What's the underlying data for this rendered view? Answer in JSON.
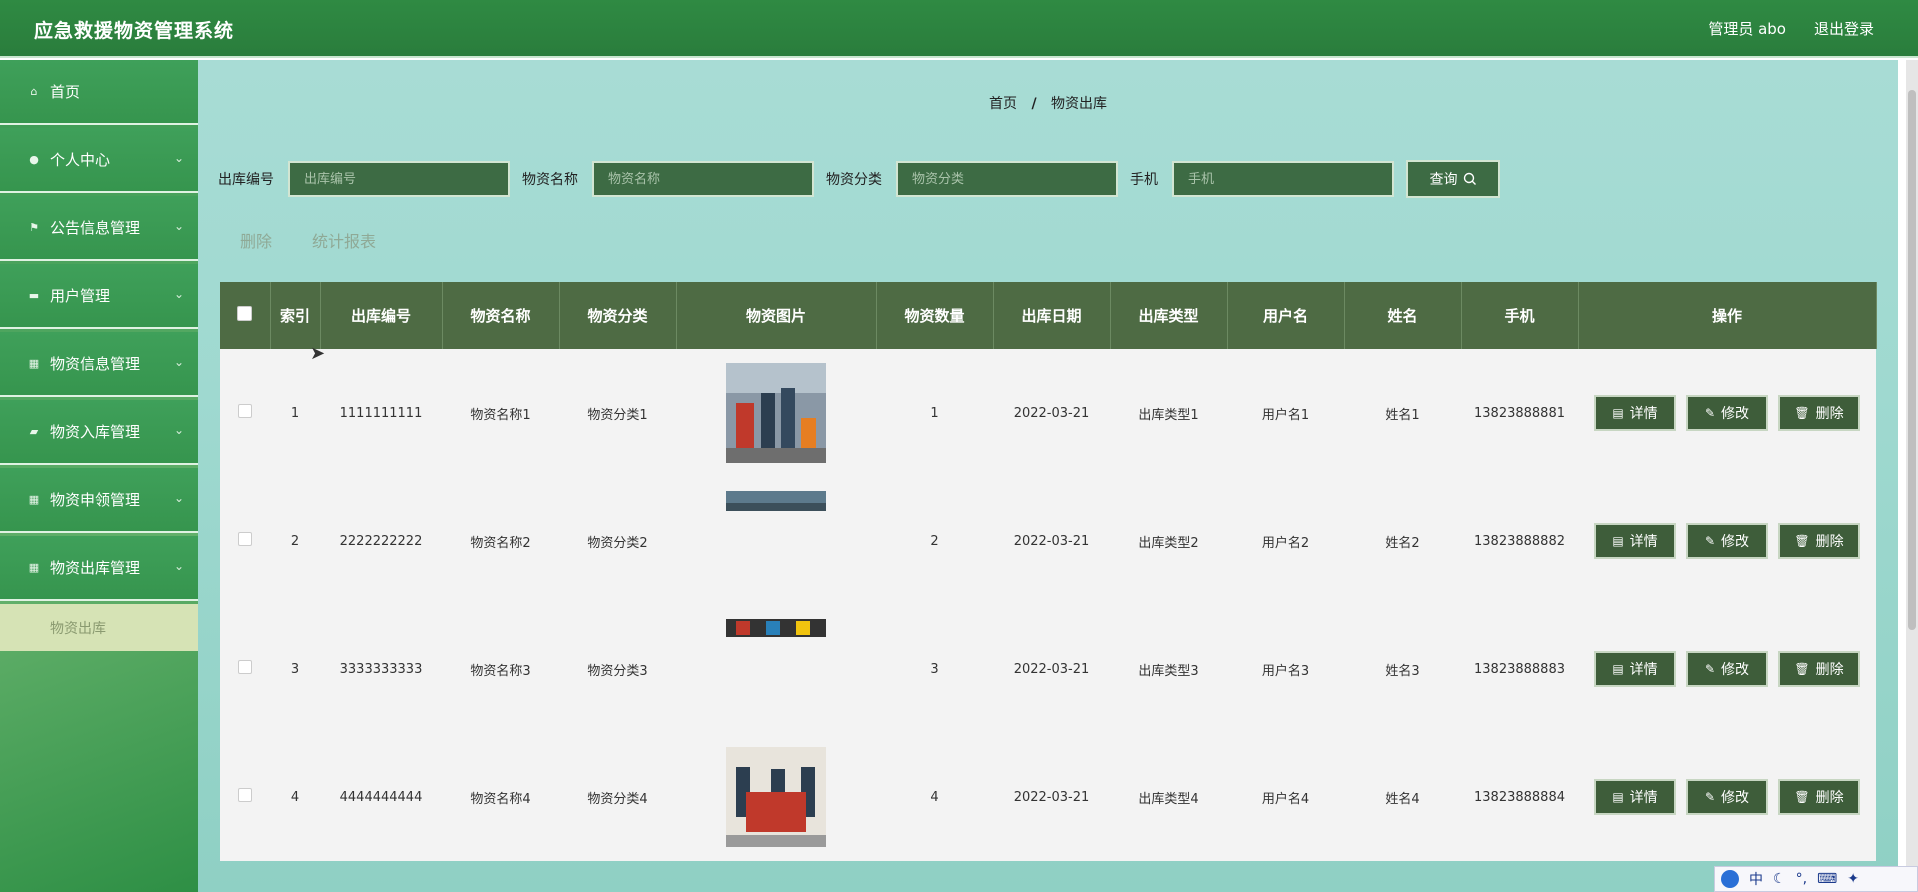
{
  "header": {
    "title": "应急救援物资管理系统",
    "user": "管理员 abo",
    "logout": "退出登录"
  },
  "sidebar": {
    "items": [
      {
        "label": "首页",
        "icon": "home-icon",
        "glyph": "⌂",
        "chevron": false
      },
      {
        "label": "个人中心",
        "icon": "user-icon",
        "glyph": "●",
        "chevron": true
      },
      {
        "label": "公告信息管理",
        "icon": "flag-icon",
        "glyph": "⚑",
        "chevron": true
      },
      {
        "label": "用户管理",
        "icon": "card-icon",
        "glyph": "▬",
        "chevron": true
      },
      {
        "label": "物资信息管理",
        "icon": "grid-icon",
        "glyph": "▦",
        "chevron": true
      },
      {
        "label": "物资入库管理",
        "icon": "comment-icon",
        "glyph": "▰",
        "chevron": true
      },
      {
        "label": "物资申领管理",
        "icon": "grid-icon",
        "glyph": "▦",
        "chevron": true
      },
      {
        "label": "物资出库管理",
        "icon": "grid-icon",
        "glyph": "▦",
        "chevron": true
      }
    ],
    "subitem": "物资出库"
  },
  "breadcrumb": {
    "home": "首页",
    "sep": "/",
    "current": "物资出库"
  },
  "search": {
    "fields": [
      {
        "label": "出库编号",
        "placeholder": "出库编号"
      },
      {
        "label": "物资名称",
        "placeholder": "物资名称"
      },
      {
        "label": "物资分类",
        "placeholder": "物资分类"
      },
      {
        "label": "手机",
        "placeholder": "手机"
      }
    ],
    "query_label": "查询",
    "query_icon": "search-icon"
  },
  "actions": {
    "delete": "删除",
    "report": "统计报表"
  },
  "table": {
    "headers": [
      "",
      "索引",
      "出库编号",
      "物资名称",
      "物资分类",
      "物资图片",
      "物资数量",
      "出库日期",
      "出库类型",
      "用户名",
      "姓名",
      "手机",
      "操作"
    ],
    "rows": [
      {
        "index": "1",
        "code": "1111111111",
        "name": "物资名称1",
        "category": "物资分类1",
        "qty": "1",
        "date": "2022-03-21",
        "type": "出库类型1",
        "username": "用户名1",
        "realname": "姓名1",
        "phone": "13823888881",
        "image": "full"
      },
      {
        "index": "2",
        "code": "2222222222",
        "name": "物资名称2",
        "category": "物资分类2",
        "qty": "2",
        "date": "2022-03-21",
        "type": "出库类型2",
        "username": "用户名2",
        "realname": "姓名2",
        "phone": "13823888882",
        "image": "strip"
      },
      {
        "index": "3",
        "code": "3333333333",
        "name": "物资名称3",
        "category": "物资分类3",
        "qty": "3",
        "date": "2022-03-21",
        "type": "出库类型3",
        "username": "用户名3",
        "realname": "姓名3",
        "phone": "13823888883",
        "image": "thin"
      },
      {
        "index": "4",
        "code": "4444444444",
        "name": "物资名称4",
        "category": "物资分类4",
        "qty": "4",
        "date": "2022-03-21",
        "type": "出库类型4",
        "username": "用户名4",
        "realname": "姓名4",
        "phone": "13823888884",
        "image": "banner"
      }
    ],
    "op_labels": {
      "detail": "详情",
      "edit": "修改",
      "delete": "删除"
    }
  },
  "ime": {
    "lang": "中"
  },
  "colors": {
    "header": "#2f8a43",
    "table_header": "#4e6b44",
    "button": "#3e5d3a"
  }
}
